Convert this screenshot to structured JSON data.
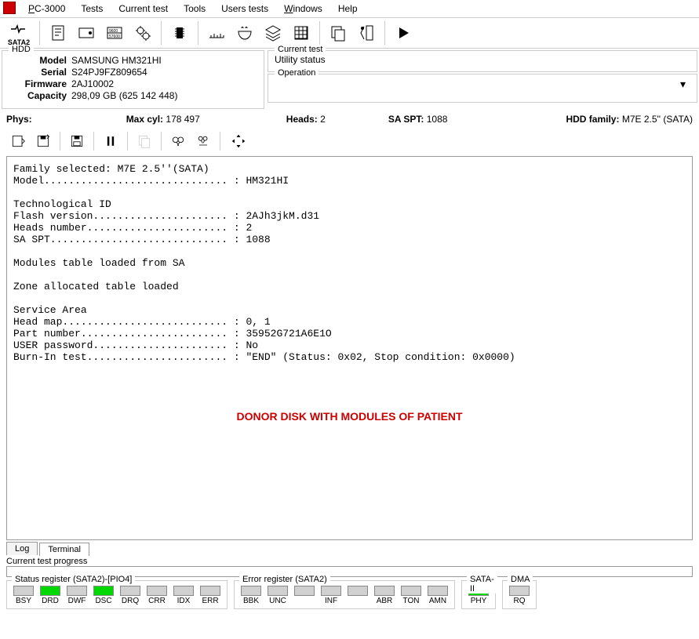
{
  "menubar": [
    "PC-3000",
    "Tests",
    "Current test",
    "Tools",
    "Users tests",
    "Windows",
    "Help"
  ],
  "sata_label": "SATA2",
  "hdd": {
    "legend": "HDD",
    "model_lbl": "Model",
    "model": "SAMSUNG HM321HI",
    "serial_lbl": "Serial",
    "serial": "S24PJ9FZ809654",
    "firmware_lbl": "Firmware",
    "firmware": "2AJ10002",
    "capacity_lbl": "Capacity",
    "capacity": "298,09 GB (625 142 448)"
  },
  "current_test": {
    "legend": "Current test",
    "status": "Utility status"
  },
  "operation": {
    "legend": "Operation"
  },
  "infobar": {
    "phys_lbl": "Phys:",
    "maxcyl_lbl": "Max cyl:",
    "maxcyl": "178 497",
    "heads_lbl": "Heads:",
    "heads": "2",
    "saspt_lbl": "SA SPT:",
    "saspt": "1088",
    "family_lbl": "HDD family:",
    "family": "M7E 2.5'' (SATA)"
  },
  "console": "Family selected: M7E 2.5''(SATA)\nModel.............................. : HM321HI\n\nTechnological ID\nFlash version...................... : 2AJh3jkM.d31\nHeads number....................... : 2\nSA SPT............................. : 1088\n\nModules table loaded from SA\n\nZone allocated table loaded\n\nService Area\nHead map........................... : 0, 1\nPart number........................ : 35952G721A6E1O\nUSER password...................... : No\nBurn-In test....................... : \"END\" (Status: 0x02, Stop condition: 0x0000)",
  "donor_note": "DONOR DISK WITH MODULES OF PATIENT",
  "tabs": {
    "log": "Log",
    "terminal": "Terminal"
  },
  "progress_label": "Current test progress",
  "status_reg": {
    "legend": "Status register (SATA2)-[PIO4]",
    "items": [
      "BSY",
      "DRD",
      "DWF",
      "DSC",
      "DRQ",
      "CRR",
      "IDX",
      "ERR"
    ],
    "green": [
      "DRD",
      "DSC"
    ]
  },
  "error_reg": {
    "legend": "Error register (SATA2)",
    "items": [
      "BBK",
      "UNC",
      "",
      "INF",
      "",
      "ABR",
      "TON",
      "AMN"
    ]
  },
  "sata2": {
    "legend": "SATA-II",
    "items": [
      "PHY"
    ],
    "green": [
      "PHY"
    ]
  },
  "dma": {
    "legend": "DMA",
    "items": [
      "RQ"
    ]
  }
}
